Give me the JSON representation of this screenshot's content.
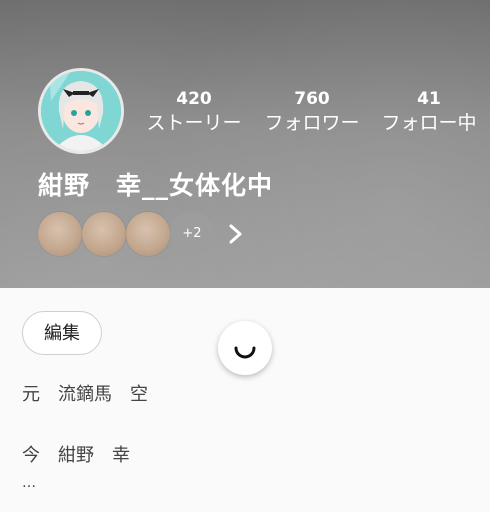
{
  "profile": {
    "name": "紺野　幸__女体化中",
    "stats": [
      {
        "value": "420",
        "label": "ストーリー"
      },
      {
        "value": "760",
        "label": "フォロワー"
      },
      {
        "value": "41",
        "label": "フォロー中"
      }
    ],
    "badges_more": "+2",
    "edit_label": "編集",
    "bio_lines": [
      "元　流鏑馬　空",
      "今　紺野　幸",
      "…"
    ]
  },
  "colors": {
    "avatar_bg": "#7fd6d3",
    "badge": "#c4a88f"
  }
}
